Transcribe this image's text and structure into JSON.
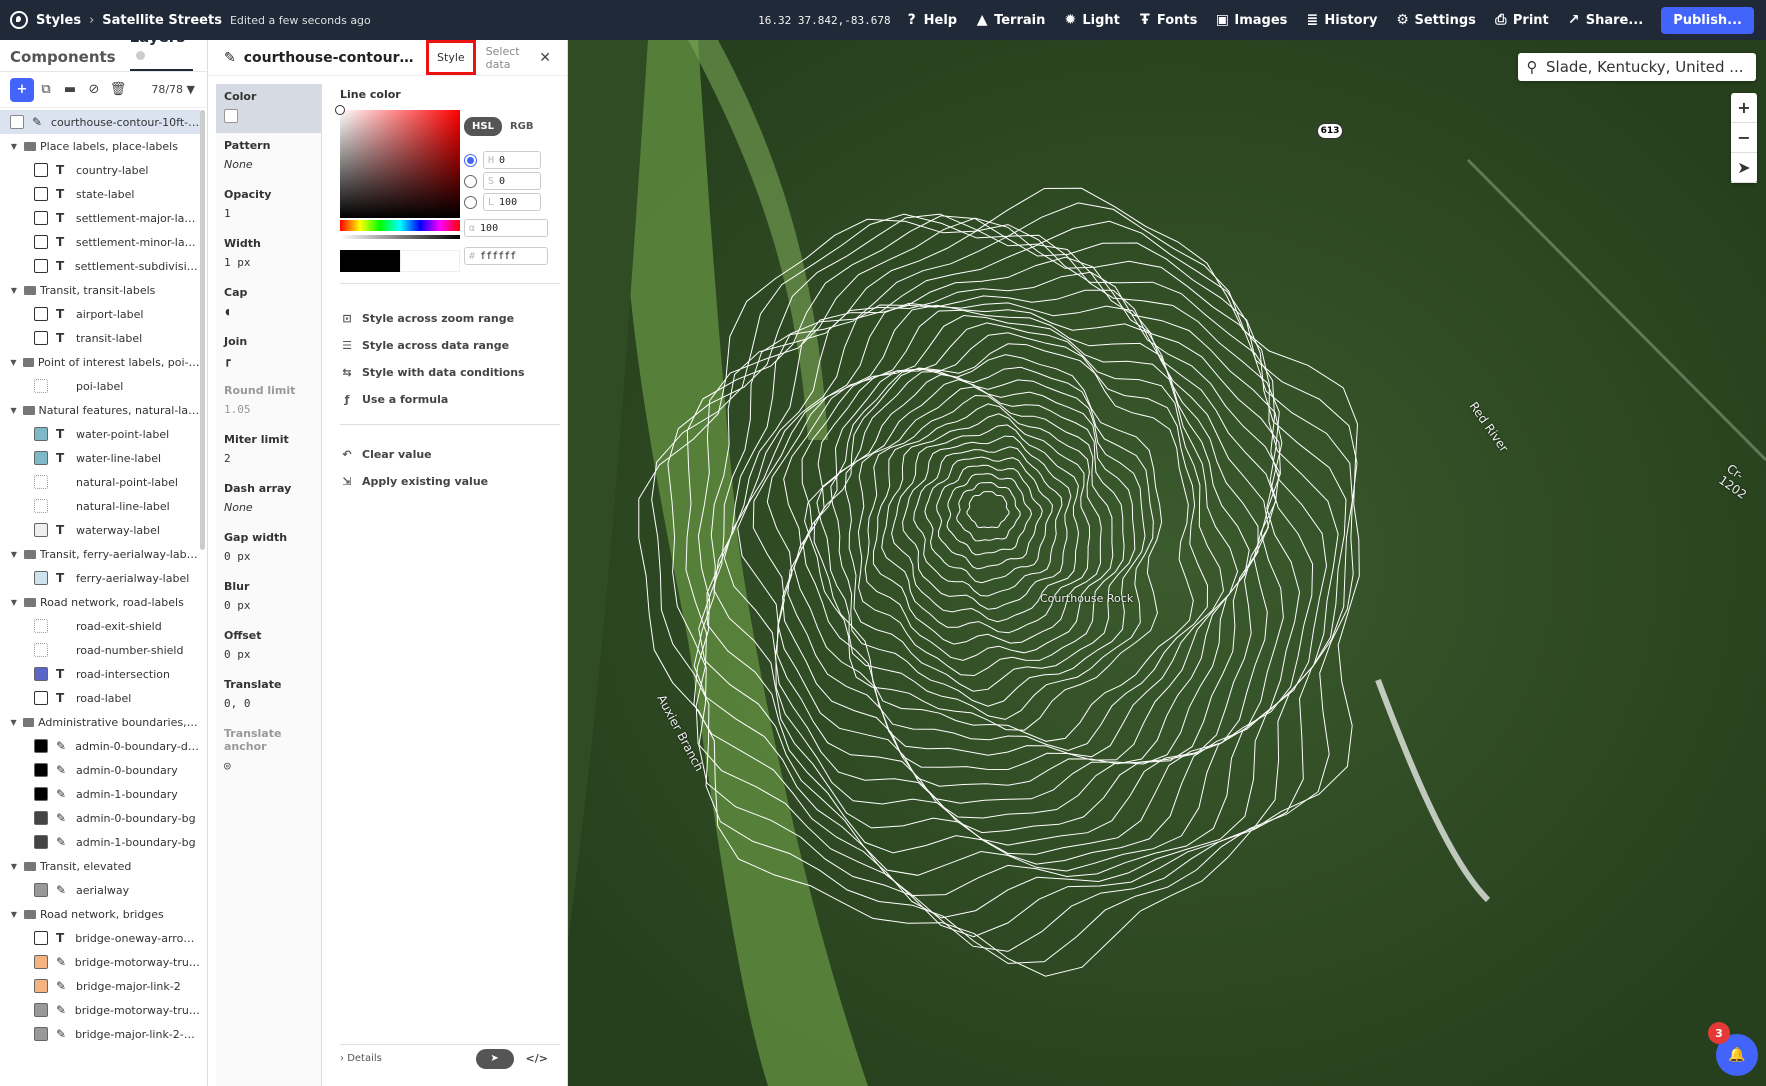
{
  "topbar": {
    "app": "Styles",
    "style_name": "Satellite Streets",
    "edited": "Edited a few seconds ago",
    "coords": "16.32 37.842,-83.678",
    "buttons": [
      "Help",
      "Terrain",
      "Light",
      "Fonts",
      "Images",
      "History",
      "Settings",
      "Print",
      "Share..."
    ],
    "publish": "Publish..."
  },
  "left": {
    "tabs": [
      "Components",
      "Layers"
    ],
    "count": "78/78",
    "layers": [
      {
        "kind": "layer",
        "name": "courthouse-contour-10ft-60...",
        "type": "line",
        "sel": true
      },
      {
        "kind": "group",
        "name": "Place labels, place-labels"
      },
      {
        "kind": "layer",
        "name": "country-label",
        "type": "T"
      },
      {
        "kind": "layer",
        "name": "state-label",
        "type": "T"
      },
      {
        "kind": "layer",
        "name": "settlement-major-label",
        "type": "T"
      },
      {
        "kind": "layer",
        "name": "settlement-minor-label",
        "type": "T"
      },
      {
        "kind": "layer",
        "name": "settlement-subdivision...",
        "type": "T"
      },
      {
        "kind": "group",
        "name": "Transit, transit-labels"
      },
      {
        "kind": "layer",
        "name": "airport-label",
        "type": "T"
      },
      {
        "kind": "layer",
        "name": "transit-label",
        "type": "T"
      },
      {
        "kind": "group",
        "name": "Point of interest labels, poi-lab..."
      },
      {
        "kind": "layer",
        "name": "poi-label",
        "type": "poi"
      },
      {
        "kind": "group",
        "name": "Natural features, natural-labels"
      },
      {
        "kind": "layer",
        "name": "water-point-label",
        "type": "T",
        "sw": "#7fb8c9"
      },
      {
        "kind": "layer",
        "name": "water-line-label",
        "type": "T",
        "sw": "#7fb8c9"
      },
      {
        "kind": "layer",
        "name": "natural-point-label",
        "type": "poi"
      },
      {
        "kind": "layer",
        "name": "natural-line-label",
        "type": "dots"
      },
      {
        "kind": "layer",
        "name": "waterway-label",
        "type": "T",
        "sw": "#eee"
      },
      {
        "kind": "group",
        "name": "Transit, ferry-aerialway-labels"
      },
      {
        "kind": "layer",
        "name": "ferry-aerialway-label",
        "type": "T",
        "sw": "#cfe3ef"
      },
      {
        "kind": "group",
        "name": "Road network, road-labels"
      },
      {
        "kind": "layer",
        "name": "road-exit-shield",
        "type": "shield"
      },
      {
        "kind": "layer",
        "name": "road-number-shield",
        "type": "shield"
      },
      {
        "kind": "layer",
        "name": "road-intersection",
        "type": "T",
        "sw": "#5a67c9"
      },
      {
        "kind": "layer",
        "name": "road-label",
        "type": "T"
      },
      {
        "kind": "group",
        "name": "Administrative boundaries, ad..."
      },
      {
        "kind": "layer",
        "name": "admin-0-boundary-dis...",
        "type": "line",
        "sw": "#000"
      },
      {
        "kind": "layer",
        "name": "admin-0-boundary",
        "type": "line",
        "sw": "#000"
      },
      {
        "kind": "layer",
        "name": "admin-1-boundary",
        "type": "line",
        "sw": "#000"
      },
      {
        "kind": "layer",
        "name": "admin-0-boundary-bg",
        "type": "line",
        "sw": "#444"
      },
      {
        "kind": "layer",
        "name": "admin-1-boundary-bg",
        "type": "line",
        "sw": "#444"
      },
      {
        "kind": "group",
        "name": "Transit, elevated"
      },
      {
        "kind": "layer",
        "name": "aerialway",
        "type": "line",
        "sw": "#999"
      },
      {
        "kind": "group",
        "name": "Road network, bridges"
      },
      {
        "kind": "layer",
        "name": "bridge-oneway-arrow-...",
        "type": "T"
      },
      {
        "kind": "layer",
        "name": "bridge-motorway-trunk...",
        "type": "line",
        "sw": "#f5b382"
      },
      {
        "kind": "layer",
        "name": "bridge-major-link-2",
        "type": "line",
        "sw": "#f5b382"
      },
      {
        "kind": "layer",
        "name": "bridge-motorway-trunk...",
        "type": "line",
        "sw": "#999"
      },
      {
        "kind": "layer",
        "name": "bridge-major-link-2-case",
        "type": "line",
        "sw": "#999"
      }
    ]
  },
  "props": {
    "title": "courthouse-contour-10f...",
    "tab_style": "Style",
    "tab_data": "Select data",
    "items": [
      {
        "label": "Color",
        "value": "",
        "swatch": true
      },
      {
        "label": "Pattern",
        "value": "None",
        "italic": true
      },
      {
        "label": "Opacity",
        "value": "1"
      },
      {
        "label": "Width",
        "value": "1 px"
      },
      {
        "label": "Cap",
        "value": "",
        "icon": "cap-icon"
      },
      {
        "label": "Join",
        "value": "",
        "icon": "join-icon"
      },
      {
        "label": "Round limit",
        "value": "1.05",
        "dim": true
      },
      {
        "label": "Miter limit",
        "value": "2"
      },
      {
        "label": "Dash array",
        "value": "None",
        "italic": true
      },
      {
        "label": "Gap width",
        "value": "0 px"
      },
      {
        "label": "Blur",
        "value": "0 px"
      },
      {
        "label": "Offset",
        "value": "0 px"
      },
      {
        "label": "Translate",
        "value": "0, 0"
      },
      {
        "label": "Translate anchor",
        "value": "",
        "icon": "anchor-icon",
        "dim": true
      }
    ]
  },
  "editor": {
    "label": "Line color",
    "modes": [
      "HSL",
      "RGB"
    ],
    "h": "0",
    "s": "0",
    "l": "100",
    "h_key": "H",
    "s_key": "S",
    "l_key": "L",
    "alpha": "100",
    "alpha_key": "α",
    "hex": "ffffff",
    "hex_key": "#",
    "actions": [
      "Style across zoom range",
      "Style across data range",
      "Style with data conditions",
      "Use a formula"
    ],
    "actions2": [
      "Clear value",
      "Apply existing value"
    ],
    "details": "Details"
  },
  "map": {
    "search": "Slade, Kentucky, United ...",
    "labels": [
      "Courthouse Rock",
      "Auxier Branch",
      "Cr-1202",
      "Red River"
    ],
    "shield": "613",
    "badge": "3"
  }
}
